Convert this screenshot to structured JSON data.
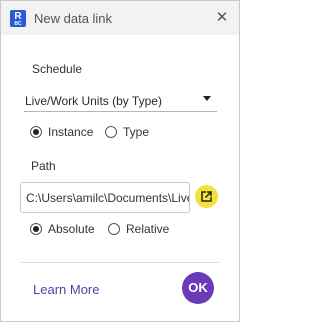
{
  "window": {
    "title": "New data link",
    "app_icon_letter": "R",
    "app_icon_subtext": "BC"
  },
  "schedule": {
    "label": "Schedule",
    "selected": "Live/Work Units (by Type)",
    "options": [
      {
        "label": "Instance",
        "checked": true
      },
      {
        "label": "Type",
        "checked": false
      }
    ]
  },
  "path": {
    "label": "Path",
    "value": "C:\\Users\\amilc\\Documents\\Live",
    "options": [
      {
        "label": "Absolute",
        "checked": true
      },
      {
        "label": "Relative",
        "checked": false
      }
    ]
  },
  "footer": {
    "learn_more": "Learn More",
    "ok": "OK"
  },
  "colors": {
    "accent": "#6a3ab8",
    "link": "#5b3aa8",
    "open_button": "#f5e236"
  },
  "icons": {
    "open": "external-link-icon",
    "close": "close-icon"
  }
}
